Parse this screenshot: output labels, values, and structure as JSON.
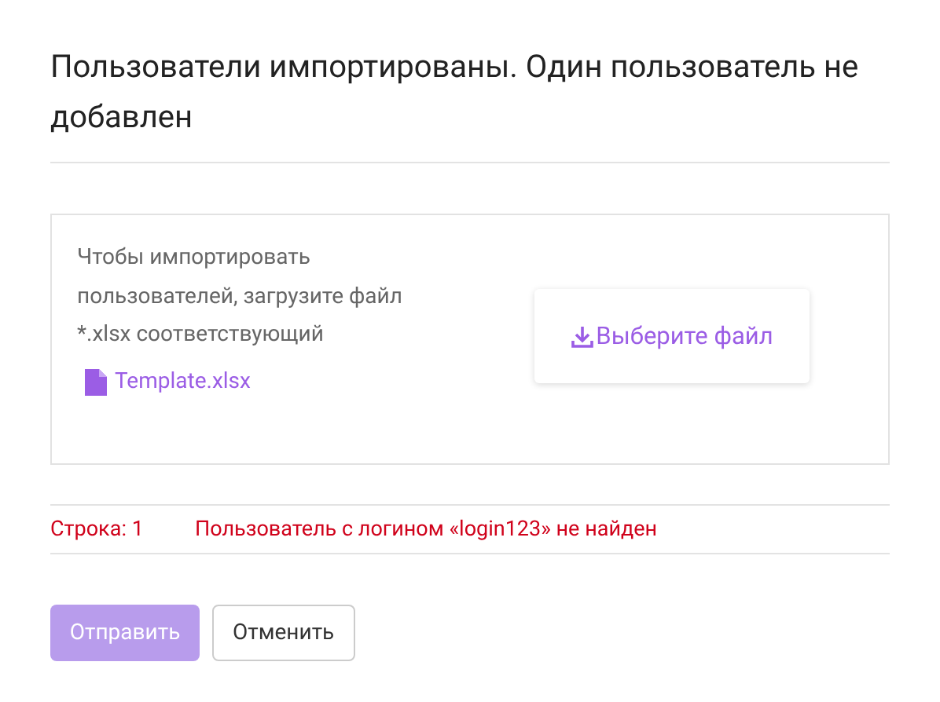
{
  "dialog": {
    "title": "Пользователи импортированы. Один пользователь не добавлен"
  },
  "upload": {
    "instructions": "Чтобы импортировать пользователей, загрузите файл *.xlsx соответствующий",
    "template_link": "Template.xlsx",
    "choose_button": "Выберите файл"
  },
  "errors": [
    {
      "row_label": "Строка: 1",
      "message": "Пользователь с логином «login123» не найден"
    }
  ],
  "buttons": [
    {
      "kind": "primary",
      "label": "Отправить",
      "disabled": true
    },
    {
      "kind": "secondary",
      "label": "Отменить",
      "disabled": false
    }
  ]
}
